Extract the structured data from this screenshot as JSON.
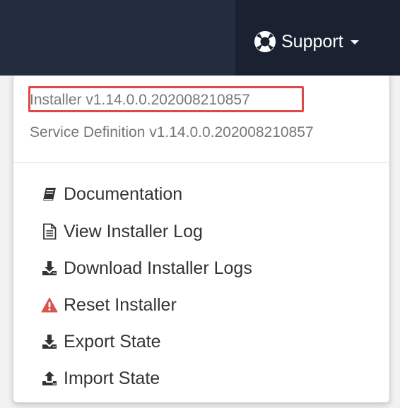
{
  "navbar": {
    "support_label": "Support",
    "background_color": "#232d3f",
    "active_background_color": "#1a2231"
  },
  "dropdown": {
    "versions": {
      "installer": "Installer v1.14.0.0.202008210857",
      "service_definition": "Service Definition v1.14.0.0.202008210857"
    },
    "items": [
      {
        "label": "Documentation",
        "icon": "book-icon"
      },
      {
        "label": "View Installer Log",
        "icon": "file-text-icon"
      },
      {
        "label": "Download Installer Logs",
        "icon": "download-icon"
      },
      {
        "label": "Reset Installer",
        "icon": "warning-icon"
      },
      {
        "label": "Export State",
        "icon": "download-icon"
      },
      {
        "label": "Import State",
        "icon": "upload-icon"
      }
    ]
  },
  "colors": {
    "highlight": "#e04848",
    "warning": "#d9534f",
    "text": "#333333",
    "muted_text": "#777777"
  }
}
